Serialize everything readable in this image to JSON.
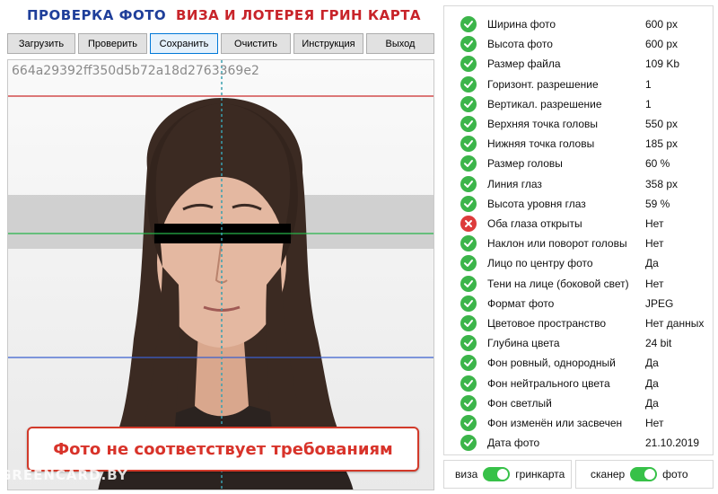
{
  "header": {
    "title_left": "ПРОВЕРКА ФОТО",
    "title_right": "ВИЗА И ЛОТЕРЕЯ ГРИН КАРТА",
    "colors": {
      "left": "#1f3f9a",
      "right": "#c8242a"
    }
  },
  "toolbar": {
    "buttons": [
      {
        "label": "Загрузить"
      },
      {
        "label": "Проверить"
      },
      {
        "label": "Сохранить",
        "active": true
      },
      {
        "label": "Очистить"
      },
      {
        "label": "Инструкция"
      },
      {
        "label": "Выход"
      }
    ]
  },
  "photo": {
    "hash": "664a29392ff350d5b72a18d2763369e2",
    "watermark": "GREENCARD.BY",
    "status": "Фото не соответствует требованиям",
    "guide_colors": {
      "top": "#cc2b2b",
      "eyes": "#26b34a",
      "bottom": "#3a5fd0",
      "center": "#3aa0b0"
    }
  },
  "checks": [
    {
      "label": "Ширина фото",
      "value": "600 px",
      "status": "ok"
    },
    {
      "label": "Высота фото",
      "value": "600 px",
      "status": "ok"
    },
    {
      "label": "Размер файла",
      "value": "109 Kb",
      "status": "ok"
    },
    {
      "label": "Горизонт. разрешение",
      "value": "1",
      "status": "ok"
    },
    {
      "label": "Вертикал. разрешение",
      "value": "1",
      "status": "ok"
    },
    {
      "label": "Верхняя точка головы",
      "value": "550 px",
      "status": "ok"
    },
    {
      "label": "Нижняя точка головы",
      "value": "185 px",
      "status": "ok"
    },
    {
      "label": "Размер головы",
      "value": "60 %",
      "status": "ok"
    },
    {
      "label": "Линия глаз",
      "value": "358 px",
      "status": "ok"
    },
    {
      "label": "Высота уровня глаз",
      "value": "59 %",
      "status": "ok"
    },
    {
      "label": "Оба глаза открыты",
      "value": "Нет",
      "status": "fail"
    },
    {
      "label": "Наклон или поворот головы",
      "value": "Нет",
      "status": "ok"
    },
    {
      "label": "Лицо по центру фото",
      "value": "Да",
      "status": "ok"
    },
    {
      "label": "Тени на лице (боковой свет)",
      "value": "Нет",
      "status": "ok"
    },
    {
      "label": "Формат фото",
      "value": "JPEG",
      "status": "ok"
    },
    {
      "label": "Цветовое пространство",
      "value": "Нет данных",
      "status": "ok"
    },
    {
      "label": "Глубина цвета",
      "value": "24 bit",
      "status": "ok"
    },
    {
      "label": "Фон ровный, однородный",
      "value": "Да",
      "status": "ok"
    },
    {
      "label": "Фон нейтрального цвета",
      "value": "Да",
      "status": "ok"
    },
    {
      "label": "Фон светлый",
      "value": "Да",
      "status": "ok"
    },
    {
      "label": "Фон изменён или засвечен",
      "value": "Нет",
      "status": "ok"
    },
    {
      "label": "Дата фото",
      "value": "21.10.2019",
      "status": "ok"
    }
  ],
  "toggles": {
    "left": {
      "off_label": "виза",
      "on_label": "гринкарта",
      "state": "on"
    },
    "right": {
      "off_label": "сканер",
      "on_label": "фото",
      "state": "on"
    }
  },
  "colors": {
    "ok": "#3cb54a",
    "fail": "#dd3b3b",
    "toggle": "#37c148"
  }
}
